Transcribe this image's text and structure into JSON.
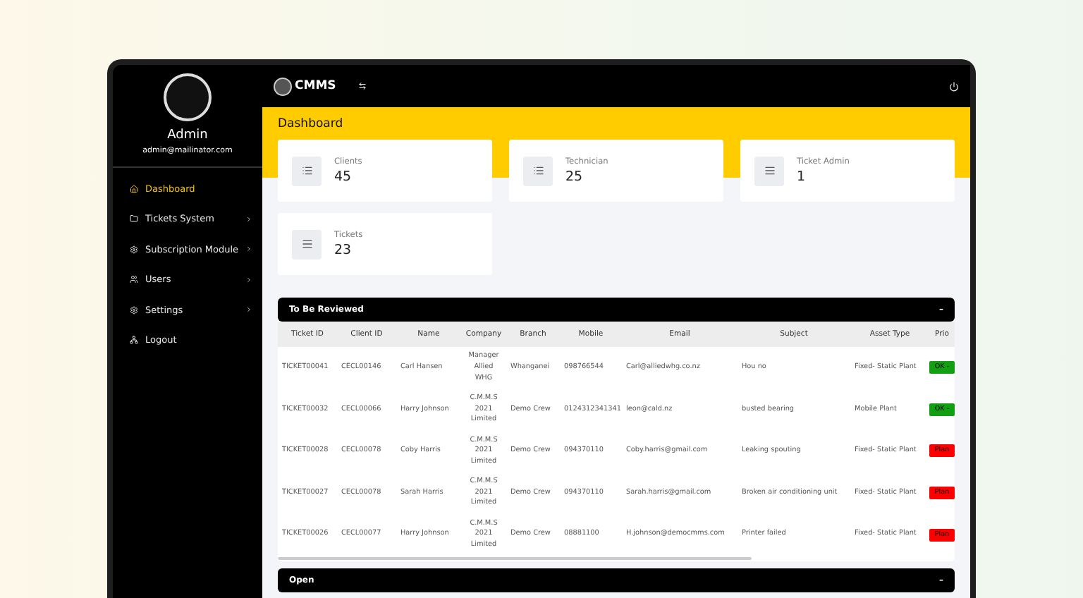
{
  "sidebar": {
    "user": {
      "name": "Admin",
      "email": "admin@mailinator.com"
    },
    "items": [
      {
        "label": "Dashboard",
        "selected": true,
        "submenu": false
      },
      {
        "label": "Tickets System",
        "selected": false,
        "submenu": true
      },
      {
        "label": "Subscription Module",
        "selected": false,
        "submenu": true
      },
      {
        "label": "Users",
        "selected": false,
        "submenu": true
      },
      {
        "label": "Settings",
        "selected": false,
        "submenu": true
      },
      {
        "label": "Logout",
        "selected": false,
        "submenu": false
      }
    ]
  },
  "topbar": {
    "brand": "CMMS"
  },
  "page_title": "Dashboard",
  "stats": [
    {
      "label": "Clients",
      "value": "45"
    },
    {
      "label": "Technician",
      "value": "25"
    },
    {
      "label": "Ticket Admin",
      "value": "1"
    },
    {
      "label": "Tickets",
      "value": "23"
    }
  ],
  "review_panel": {
    "title": "To Be Reviewed",
    "toggle": "–",
    "columns": [
      "Ticket ID",
      "Client ID",
      "Name",
      "Company",
      "Branch",
      "Mobile",
      "Email",
      "Subject",
      "Asset Type",
      "Prio"
    ],
    "rows": [
      {
        "cells": [
          "TICKET00041",
          "CECL00146",
          "Carl Hansen",
          "Manager Allied WHG",
          "Whanganei",
          "098766544",
          "Carl@alliedwhg.co.nz",
          "Hou no",
          "Fixed- Static Plant"
        ],
        "priority": {
          "label": "OK -",
          "color": "#12a012"
        }
      },
      {
        "cells": [
          "TICKET00032",
          "CECL00066",
          "Harry Johnson",
          "C.M.M.S 2021 Limited",
          "Demo Crew",
          "0124312341341",
          "leon@cald.nz",
          "busted bearing",
          "Mobile Plant"
        ],
        "priority": {
          "label": "OK -",
          "color": "#12a012"
        }
      },
      {
        "cells": [
          "TICKET00028",
          "CECL00078",
          "Coby Harris",
          "C.M.M.S 2021 Limited",
          "Demo Crew",
          "094370110",
          "Coby.harris@gmail.com",
          "Leaking spouting",
          "Fixed- Static Plant"
        ],
        "priority": {
          "label": "Plan",
          "color": "#ff0000"
        }
      },
      {
        "cells": [
          "TICKET00027",
          "CECL00078",
          "Sarah Harris",
          "C.M.M.S 2021 Limited",
          "Demo Crew",
          "094370110",
          "Sarah.harris@gmail.com",
          "Broken air conditioning unit",
          "Fixed- Static Plant"
        ],
        "priority": {
          "label": "Plan",
          "color": "#ff0000"
        }
      },
      {
        "cells": [
          "TICKET00026",
          "CECL00077",
          "Harry Johnson",
          "C.M.M.S 2021 Limited",
          "Demo Crew",
          "08881100",
          "H.johnson@democmms.com",
          "Printer failed",
          "Fixed- Static Plant"
        ],
        "priority": {
          "label": "Plan",
          "color": "#ff0000"
        }
      }
    ]
  },
  "open_panel": {
    "title": "Open",
    "toggle": "–"
  }
}
